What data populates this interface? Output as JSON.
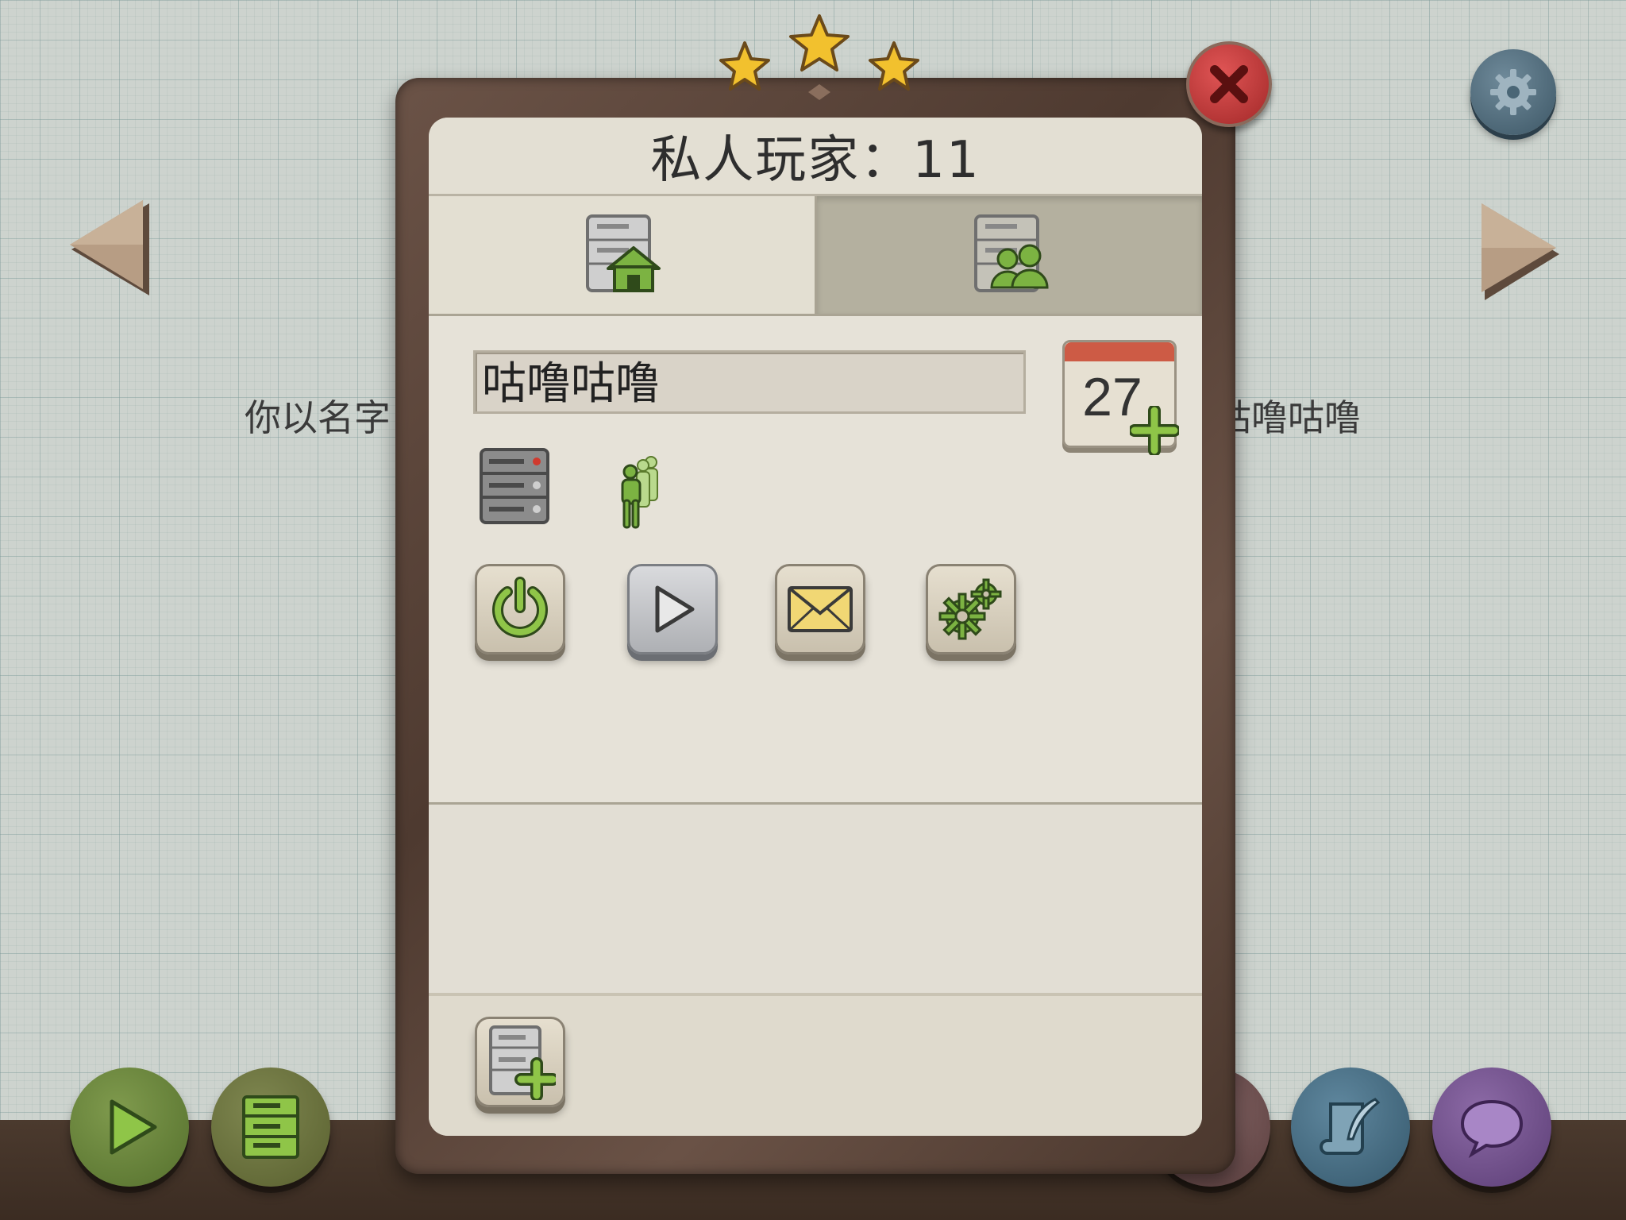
{
  "background_text": {
    "left": "你以名字",
    "right": "咕噜咕噜"
  },
  "dialog": {
    "title": "私人玩家：11",
    "tabs": [
      {
        "icon": "server-home-icon",
        "active": true
      },
      {
        "icon": "server-multiplayer-icon",
        "active": false
      }
    ],
    "server_name": "咕噜咕噜",
    "calendar_day": "27",
    "actions": [
      "power-icon",
      "play-icon",
      "mail-icon",
      "gears-icon"
    ],
    "footer_action": "add-server-icon"
  },
  "colors": {
    "accent_green": "#7cb342",
    "close_red": "#c0392b",
    "frame_brown": "#5a4336"
  }
}
